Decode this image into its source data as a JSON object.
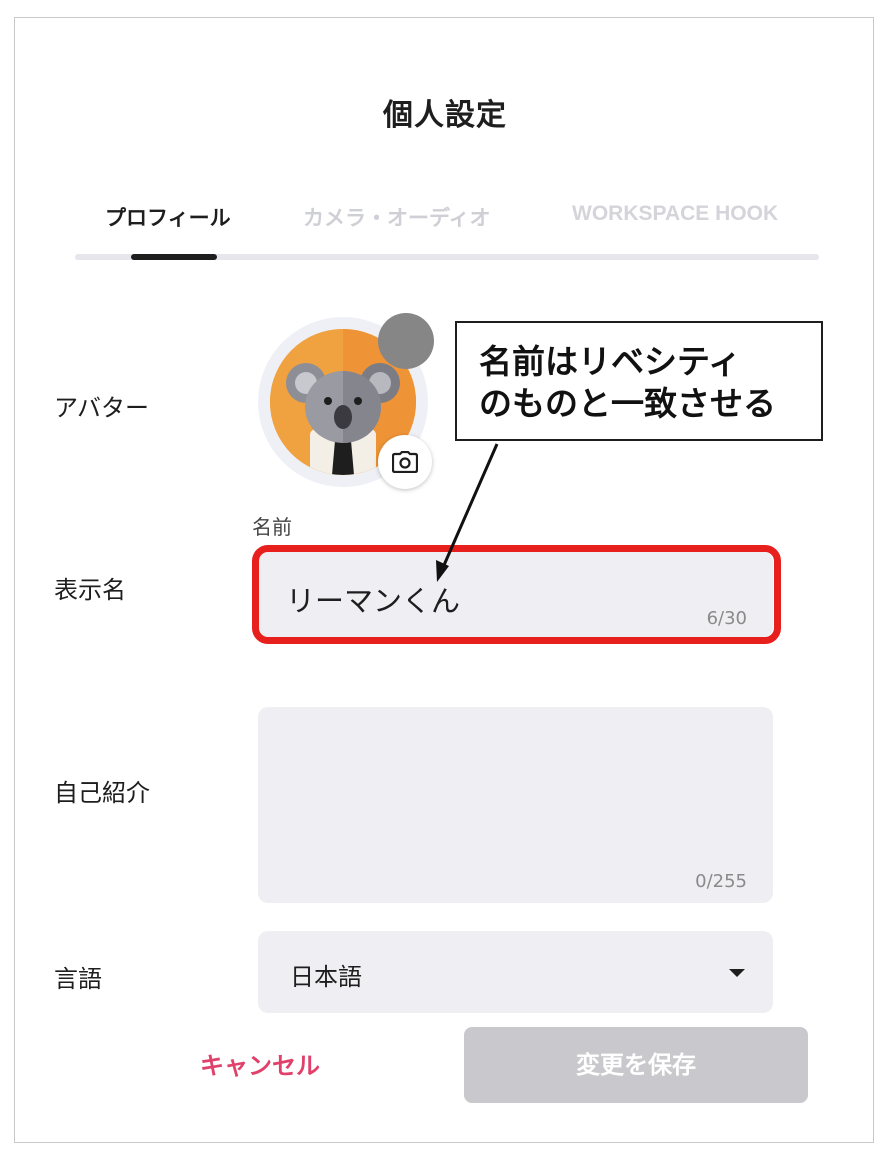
{
  "header": {
    "title": "個人設定"
  },
  "tabs": [
    {
      "label": "プロフィール",
      "active": true
    },
    {
      "label": "カメラ・オーディオ",
      "active": false
    },
    {
      "label": "WORKSPACE HOOK",
      "active": false
    }
  ],
  "profile": {
    "avatar_label": "アバター",
    "display_name_label": "表示名",
    "name_caption": "名前",
    "name_value": "リーマンくん",
    "name_counter": "6/30",
    "bio_label": "自己紹介",
    "bio_value": "",
    "bio_counter": "0/255",
    "language_label": "言語",
    "language_value": "日本語"
  },
  "annotation": {
    "line1": "名前はリベシティ",
    "line2": "のものと一致させる",
    "highlight_color": "#e8201d"
  },
  "actions": {
    "cancel_label": "キャンセル",
    "save_label": "変更を保存"
  },
  "colors": {
    "accent": "#e0406a",
    "disabled": "#c9c9cd",
    "avatar_bg": "#f0a240",
    "status_dot": "#868686"
  },
  "icons": {
    "camera": "camera-icon",
    "caret": "caret-down-icon"
  }
}
